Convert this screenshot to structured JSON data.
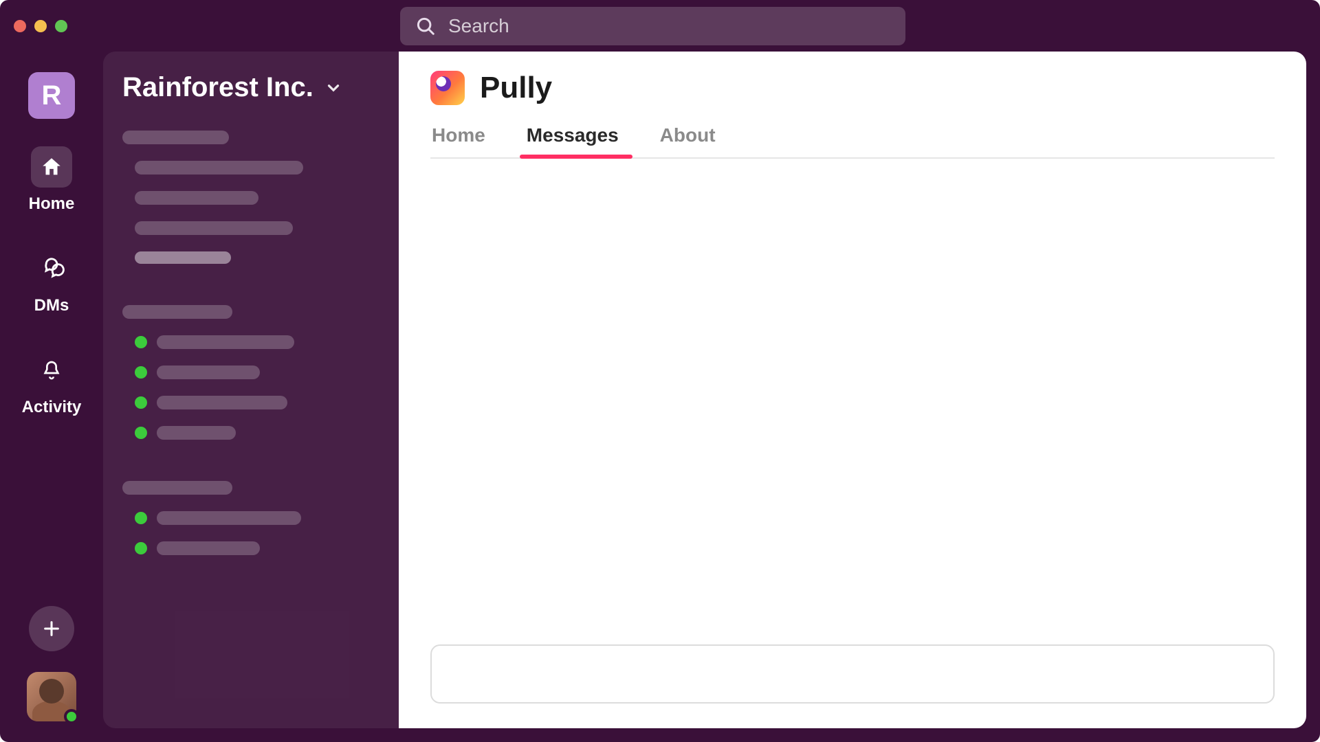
{
  "workspace": {
    "initial": "R",
    "name": "Rainforest Inc."
  },
  "search": {
    "placeholder": "Search"
  },
  "rail": {
    "home": "Home",
    "dms": "DMs",
    "activity": "Activity"
  },
  "main": {
    "app_name": "Pully",
    "tabs": {
      "home": "Home",
      "messages": "Messages",
      "about": "About"
    },
    "active_tab": "messages"
  }
}
